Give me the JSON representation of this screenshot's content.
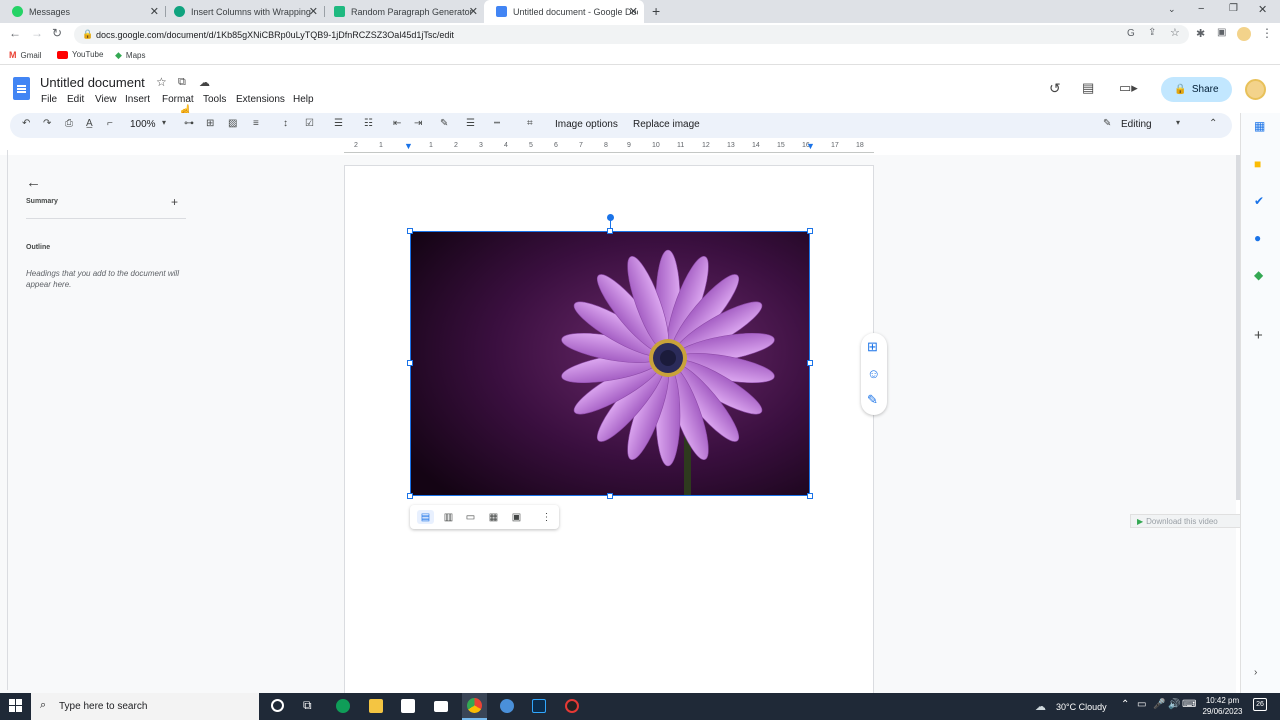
{
  "tabs": [
    {
      "title": "Messages",
      "fav_color": "#25d366"
    },
    {
      "title": "Insert Columns with Wrapping",
      "fav_color": "#10a37f"
    },
    {
      "title": "Random Paragraph Generator —",
      "fav_color": "#1eb980"
    },
    {
      "title": "Untitled document - Google Doc",
      "fav_color": "#4285f4"
    }
  ],
  "address": {
    "url": "docs.google.com/document/d/1Kb85gXNiCBRp0uLyTQB9-1jDfnRCZSZ3Oal45d1jTsc/edit"
  },
  "bookmarks": [
    {
      "label": "Gmail",
      "icon": "gmail-icon"
    },
    {
      "label": "YouTube",
      "icon": "youtube-icon"
    },
    {
      "label": "Maps",
      "icon": "maps-icon"
    }
  ],
  "doc": {
    "title": "Untitled document",
    "menus": [
      "File",
      "Edit",
      "View",
      "Insert",
      "Format",
      "Tools",
      "Extensions",
      "Help"
    ],
    "share_label": "Share"
  },
  "toolbar": {
    "zoom": "100%",
    "image_options": "Image options",
    "replace_image": "Replace image",
    "mode": "Editing"
  },
  "sidebar": {
    "summary": "Summary",
    "outline": "Outline",
    "outline_hint": "Headings that you add to the document will appear here."
  },
  "ruler": {
    "marks": [
      "2",
      "1",
      "1",
      "2",
      "3",
      "4",
      "5",
      "6",
      "7",
      "8",
      "9",
      "10",
      "11",
      "12",
      "13",
      "14",
      "15",
      "16",
      "17",
      "18"
    ]
  },
  "overlay": {
    "download": "Download this video"
  },
  "taskbar": {
    "search_placeholder": "Type here to search",
    "weather": "30°C  Cloudy",
    "time": "10:42 pm",
    "date": "29/06/2023",
    "notifications": "26"
  },
  "colors": {
    "accent": "#1a73e8",
    "share_bg": "#c2e7ff",
    "flower_petal": "#c98ee6",
    "background_purple": "#3a0f3f"
  }
}
